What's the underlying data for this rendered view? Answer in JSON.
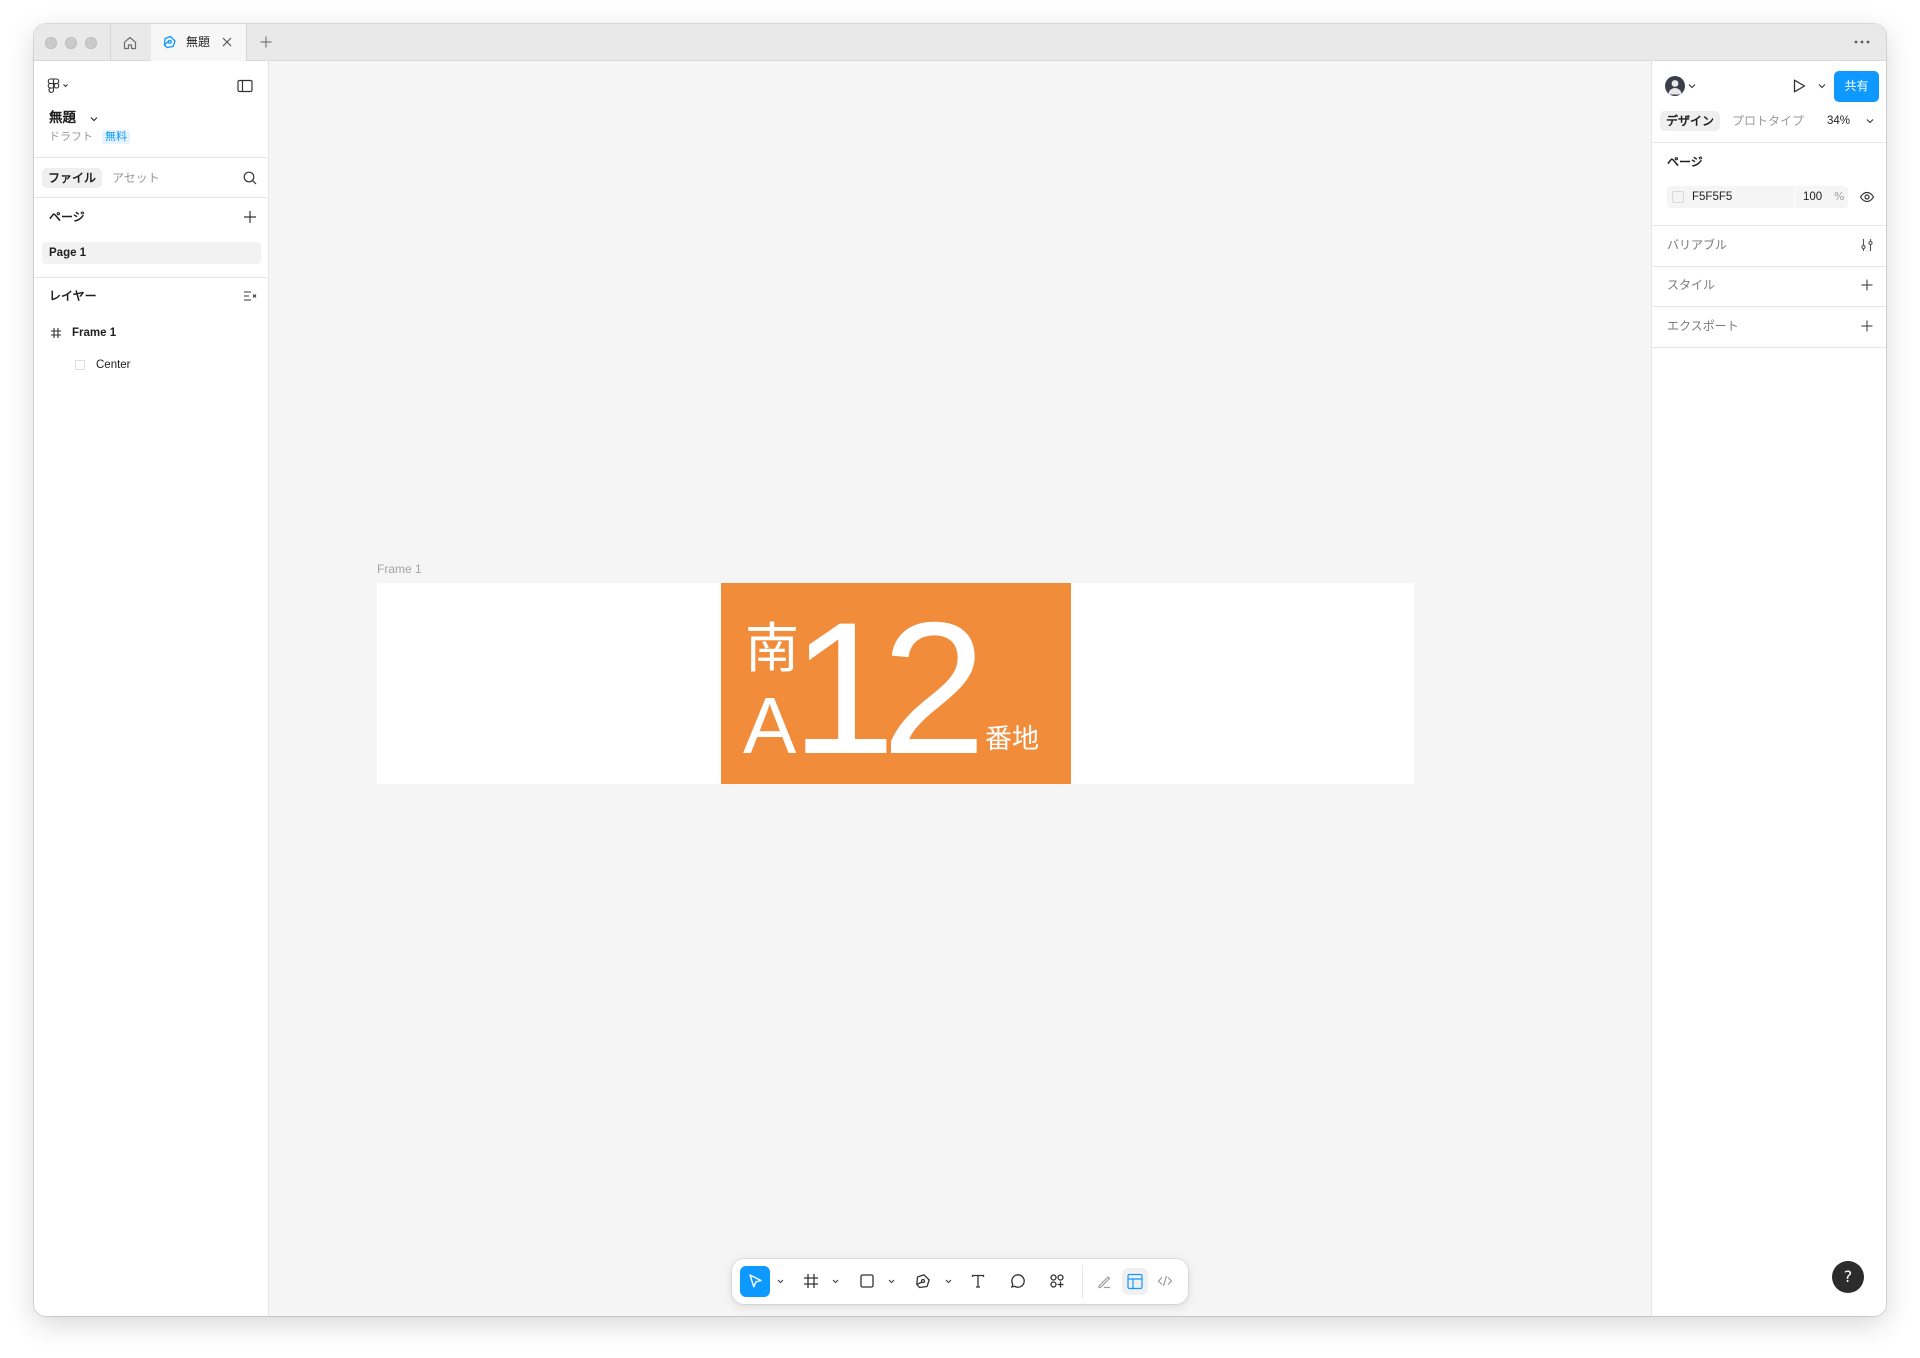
{
  "titlebar": {
    "tab_title": "無題"
  },
  "file": {
    "name": "無題",
    "location": "ドラフト",
    "plan_badge": "無料"
  },
  "left_panel": {
    "tabs": [
      {
        "label": "ファイル",
        "active": true
      },
      {
        "label": "アセット",
        "active": false
      }
    ],
    "pages_heading": "ページ",
    "pages": [
      "Page 1"
    ],
    "layers_heading": "レイヤー",
    "layers": [
      {
        "name": "Frame 1",
        "type": "frame"
      },
      {
        "name": "Center",
        "type": "rectangle"
      }
    ]
  },
  "right_panel": {
    "share_label": "共有",
    "tabs": [
      {
        "label": "デザイン",
        "active": true
      },
      {
        "label": "プロトタイプ",
        "active": false
      }
    ],
    "zoom": "34%",
    "page": {
      "heading": "ページ",
      "fill_hex": "F5F5F5",
      "opacity": "100",
      "opacity_unit": "%"
    },
    "sections": [
      "バリアブル",
      "スタイル",
      "エクスポート"
    ]
  },
  "canvas": {
    "frame_label": "Frame 1",
    "sign": {
      "top_char": "南",
      "bottom_char": "A",
      "number": "12",
      "suffix": "番地"
    }
  },
  "toolbar": {
    "tools": [
      "move-tool",
      "frame-tool",
      "rectangle-tool",
      "pen-tool",
      "text-tool",
      "comment-tool",
      "actions-tool",
      "draw-mode",
      "design-mode",
      "dev-mode"
    ],
    "active_tool": "move-tool"
  },
  "help": {
    "label": "?"
  },
  "colors": {
    "accent": "#0d99ff",
    "sign": "#f08c3a",
    "canvas": "#f5f5f5",
    "helpbg": "#2c2c2c"
  },
  "icons": {
    "home": "home-icon",
    "file": "figma-file-icon",
    "close": "close-icon",
    "new_tab": "plus-icon",
    "more": "more-icon",
    "logo": "figma-logo-icon",
    "sidebar": "sidebar-toggle-icon",
    "search": "search-icon",
    "eye": "eye-icon",
    "play": "play-icon"
  }
}
